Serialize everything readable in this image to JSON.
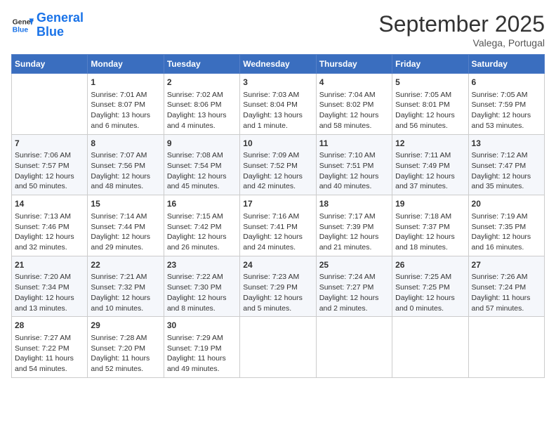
{
  "header": {
    "logo_line1": "General",
    "logo_line2": "Blue",
    "month_title": "September 2025",
    "location": "Valega, Portugal"
  },
  "weekdays": [
    "Sunday",
    "Monday",
    "Tuesday",
    "Wednesday",
    "Thursday",
    "Friday",
    "Saturday"
  ],
  "weeks": [
    [
      {
        "day": "",
        "info": ""
      },
      {
        "day": "1",
        "info": "Sunrise: 7:01 AM\nSunset: 8:07 PM\nDaylight: 13 hours\nand 6 minutes."
      },
      {
        "day": "2",
        "info": "Sunrise: 7:02 AM\nSunset: 8:06 PM\nDaylight: 13 hours\nand 4 minutes."
      },
      {
        "day": "3",
        "info": "Sunrise: 7:03 AM\nSunset: 8:04 PM\nDaylight: 13 hours\nand 1 minute."
      },
      {
        "day": "4",
        "info": "Sunrise: 7:04 AM\nSunset: 8:02 PM\nDaylight: 12 hours\nand 58 minutes."
      },
      {
        "day": "5",
        "info": "Sunrise: 7:05 AM\nSunset: 8:01 PM\nDaylight: 12 hours\nand 56 minutes."
      },
      {
        "day": "6",
        "info": "Sunrise: 7:05 AM\nSunset: 7:59 PM\nDaylight: 12 hours\nand 53 minutes."
      }
    ],
    [
      {
        "day": "7",
        "info": "Sunrise: 7:06 AM\nSunset: 7:57 PM\nDaylight: 12 hours\nand 50 minutes."
      },
      {
        "day": "8",
        "info": "Sunrise: 7:07 AM\nSunset: 7:56 PM\nDaylight: 12 hours\nand 48 minutes."
      },
      {
        "day": "9",
        "info": "Sunrise: 7:08 AM\nSunset: 7:54 PM\nDaylight: 12 hours\nand 45 minutes."
      },
      {
        "day": "10",
        "info": "Sunrise: 7:09 AM\nSunset: 7:52 PM\nDaylight: 12 hours\nand 42 minutes."
      },
      {
        "day": "11",
        "info": "Sunrise: 7:10 AM\nSunset: 7:51 PM\nDaylight: 12 hours\nand 40 minutes."
      },
      {
        "day": "12",
        "info": "Sunrise: 7:11 AM\nSunset: 7:49 PM\nDaylight: 12 hours\nand 37 minutes."
      },
      {
        "day": "13",
        "info": "Sunrise: 7:12 AM\nSunset: 7:47 PM\nDaylight: 12 hours\nand 35 minutes."
      }
    ],
    [
      {
        "day": "14",
        "info": "Sunrise: 7:13 AM\nSunset: 7:46 PM\nDaylight: 12 hours\nand 32 minutes."
      },
      {
        "day": "15",
        "info": "Sunrise: 7:14 AM\nSunset: 7:44 PM\nDaylight: 12 hours\nand 29 minutes."
      },
      {
        "day": "16",
        "info": "Sunrise: 7:15 AM\nSunset: 7:42 PM\nDaylight: 12 hours\nand 26 minutes."
      },
      {
        "day": "17",
        "info": "Sunrise: 7:16 AM\nSunset: 7:41 PM\nDaylight: 12 hours\nand 24 minutes."
      },
      {
        "day": "18",
        "info": "Sunrise: 7:17 AM\nSunset: 7:39 PM\nDaylight: 12 hours\nand 21 minutes."
      },
      {
        "day": "19",
        "info": "Sunrise: 7:18 AM\nSunset: 7:37 PM\nDaylight: 12 hours\nand 18 minutes."
      },
      {
        "day": "20",
        "info": "Sunrise: 7:19 AM\nSunset: 7:35 PM\nDaylight: 12 hours\nand 16 minutes."
      }
    ],
    [
      {
        "day": "21",
        "info": "Sunrise: 7:20 AM\nSunset: 7:34 PM\nDaylight: 12 hours\nand 13 minutes."
      },
      {
        "day": "22",
        "info": "Sunrise: 7:21 AM\nSunset: 7:32 PM\nDaylight: 12 hours\nand 10 minutes."
      },
      {
        "day": "23",
        "info": "Sunrise: 7:22 AM\nSunset: 7:30 PM\nDaylight: 12 hours\nand 8 minutes."
      },
      {
        "day": "24",
        "info": "Sunrise: 7:23 AM\nSunset: 7:29 PM\nDaylight: 12 hours\nand 5 minutes."
      },
      {
        "day": "25",
        "info": "Sunrise: 7:24 AM\nSunset: 7:27 PM\nDaylight: 12 hours\nand 2 minutes."
      },
      {
        "day": "26",
        "info": "Sunrise: 7:25 AM\nSunset: 7:25 PM\nDaylight: 12 hours\nand 0 minutes."
      },
      {
        "day": "27",
        "info": "Sunrise: 7:26 AM\nSunset: 7:24 PM\nDaylight: 11 hours\nand 57 minutes."
      }
    ],
    [
      {
        "day": "28",
        "info": "Sunrise: 7:27 AM\nSunset: 7:22 PM\nDaylight: 11 hours\nand 54 minutes."
      },
      {
        "day": "29",
        "info": "Sunrise: 7:28 AM\nSunset: 7:20 PM\nDaylight: 11 hours\nand 52 minutes."
      },
      {
        "day": "30",
        "info": "Sunrise: 7:29 AM\nSunset: 7:19 PM\nDaylight: 11 hours\nand 49 minutes."
      },
      {
        "day": "",
        "info": ""
      },
      {
        "day": "",
        "info": ""
      },
      {
        "day": "",
        "info": ""
      },
      {
        "day": "",
        "info": ""
      }
    ]
  ]
}
